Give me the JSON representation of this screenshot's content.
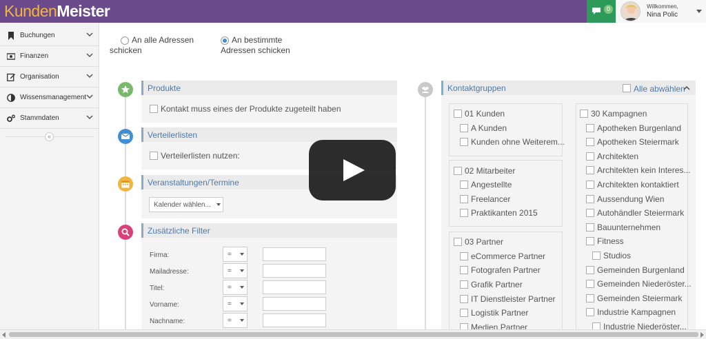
{
  "app": {
    "logo_part1": "Kunden",
    "logo_part2": "Meister",
    "chat_count": "0",
    "welcome": "Willkommen,",
    "user_name": "Nina Polic"
  },
  "sidebar": {
    "items": [
      {
        "label": "Buchungen",
        "icon": "bookmark-icon"
      },
      {
        "label": "Finanzen",
        "icon": "money-icon"
      },
      {
        "label": "Organisation",
        "icon": "edit-icon"
      },
      {
        "label": "Wissensmanagement",
        "icon": "contrast-icon"
      },
      {
        "label": "Stammdaten",
        "icon": "cogs-icon"
      }
    ],
    "collapse_glyph": "«"
  },
  "recipients": {
    "option1_line1": "An alle Adressen",
    "option1_line2": "schicken",
    "option2_line1": "An bestimmte",
    "option2_line2": "Adressen schicken",
    "selected": "option2"
  },
  "sections": {
    "produkte": {
      "title": "Produkte",
      "checkbox": "Kontakt muss eines der Produkte zugeteilt haben"
    },
    "verteilerlisten": {
      "title": "Verteilerlisten",
      "checkbox": "Verteilerlisten nutzen:"
    },
    "veranstaltungen": {
      "title": "Veranstaltungen/Termine",
      "select": "Kalender wählen..."
    },
    "filter": {
      "title": "Zusätzliche Filter",
      "operator": "=",
      "rows": [
        {
          "label": "Firma:"
        },
        {
          "label": "Mailadresse:"
        },
        {
          "label": "Titel:"
        },
        {
          "label": "Vorname:"
        },
        {
          "label": "Nachname:"
        }
      ]
    }
  },
  "contact_groups": {
    "title": "Kontaktgruppen",
    "deselect_all": "Alle abwählen",
    "col1": [
      {
        "name": "01 Kunden",
        "children": [
          "A Kunden",
          "Kunden ohne Weiterem..."
        ]
      },
      {
        "name": "02 Mitarbeiter",
        "children": [
          "Angestellte",
          "Freelancer",
          "Praktikanten 2015"
        ]
      },
      {
        "name": "03 Partner",
        "children": [
          "eCommerce Partner",
          "Fotografen Partner",
          "Grafik Partner",
          "IT Dienstleister Partner",
          "Logistik Partner",
          "Medien Partner"
        ]
      }
    ],
    "col2": {
      "name": "30 Kampagnen",
      "children": [
        "Apotheken Burgenland",
        "Apotheken Steiermark",
        "Architekten",
        "Architekten kein Interes...",
        "Architekten kontaktiert",
        "Aussendung Wien",
        "Autohändler Steiermark",
        "Bauunternehmen",
        "Fitness",
        "Studios",
        "Gemeinden Burgenland",
        "Gemeinden Niederöster...",
        "Gemeinden Steiermark",
        "Industrie Kampagnen",
        "Industrie Niederöster..."
      ]
    }
  },
  "colors": {
    "topbar": "#6b4a8c",
    "step_produkte": "#7ab86b",
    "step_verteiler": "#3f8fd2",
    "step_veranstaltung": "#f0b540",
    "step_filter": "#d8417a",
    "step_kontakt": "#c9c9c9"
  }
}
